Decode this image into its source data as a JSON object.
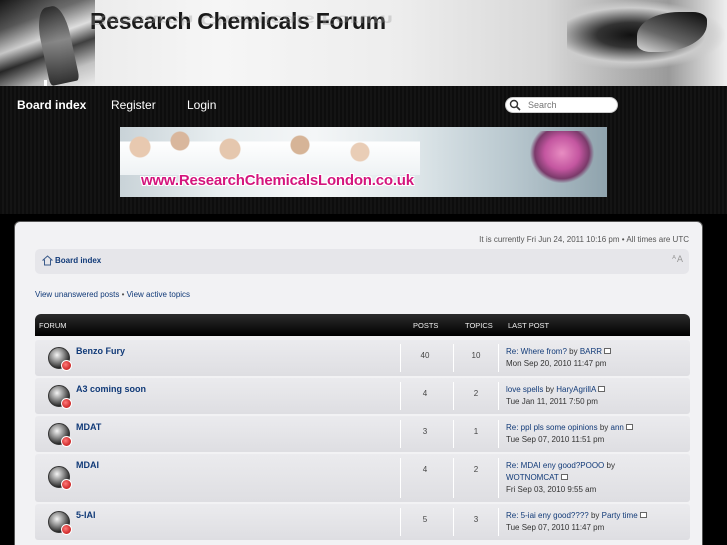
{
  "header": {
    "title": "Research Chemicals Forum"
  },
  "nav": {
    "board_index": "Board index",
    "register": "Register",
    "login": "Login"
  },
  "search": {
    "placeholder": "Search"
  },
  "banner": {
    "url_text": "www.ResearchChemicalsLondon.co.uk"
  },
  "main": {
    "datetime": "It is currently Fri Jun 24, 2011 10:16 pm • All times are UTC",
    "breadcrumb": "Board index",
    "unanswered": "View unanswered posts",
    "links_sep": " • ",
    "active": "View active topics"
  },
  "table": {
    "headers": {
      "forum": "FORUM",
      "posts": "POSTS",
      "topics": "TOPICS",
      "last_post": "LAST POST"
    },
    "rows": [
      {
        "name": "Benzo Fury",
        "posts": "40",
        "topics": "10",
        "last_title": "Re: Where from?",
        "by": " by ",
        "author": "BARR",
        "date": "Mon Sep 20, 2010 11:47 pm"
      },
      {
        "name": "A3 coming soon",
        "posts": "4",
        "topics": "2",
        "last_title": "love spells",
        "by": " by ",
        "author": "HaryAgrillA",
        "date": "Tue Jan 11, 2011 7:50 pm"
      },
      {
        "name": "MDAT",
        "posts": "3",
        "topics": "1",
        "last_title": "Re: ppl pls some opinions",
        "by": " by ",
        "author": "ann",
        "date": "Tue Sep 07, 2010 11:51 pm"
      },
      {
        "name": "MDAI",
        "posts": "4",
        "topics": "2",
        "last_title": "Re: MDAI eny good?POOO",
        "by": " by ",
        "author": "WOTNOMCAT",
        "date": "Fri Sep 03, 2010 9:55 am"
      },
      {
        "name": "5-IAI",
        "posts": "5",
        "topics": "3",
        "last_title": "Re: 5-iai eny good????",
        "by": " by ",
        "author": "Party time",
        "date": "Tue Sep 07, 2010 11:47 pm"
      }
    ]
  },
  "colors": {
    "link": "#113a78",
    "banner_url": "#d4157d",
    "nav_bg": "#0d0d0d"
  }
}
